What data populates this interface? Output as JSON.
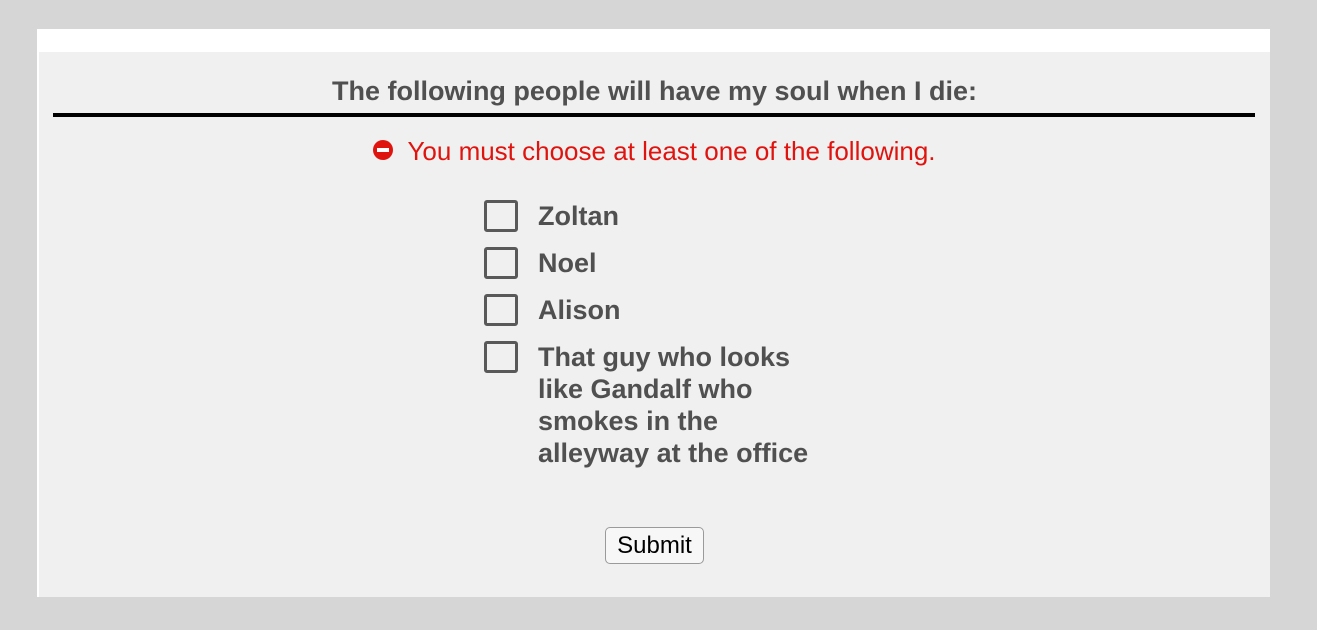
{
  "form": {
    "legend": "The following people will have my soul when I die:",
    "error": {
      "icon": "error-circle-icon",
      "message": "You must choose at least one of the following."
    },
    "options": [
      {
        "label": "Zoltan",
        "checked": false
      },
      {
        "label": "Noel",
        "checked": false
      },
      {
        "label": "Alison",
        "checked": false
      },
      {
        "label": "That guy who looks like Gandalf who smokes in the alleyway at the office",
        "checked": false
      }
    ],
    "submit_label": "Submit"
  },
  "colors": {
    "page_background": "#d6d6d6",
    "panel_background": "#f0f0f0",
    "text": "#505050",
    "error": "#e0140f",
    "rule": "#000000"
  }
}
